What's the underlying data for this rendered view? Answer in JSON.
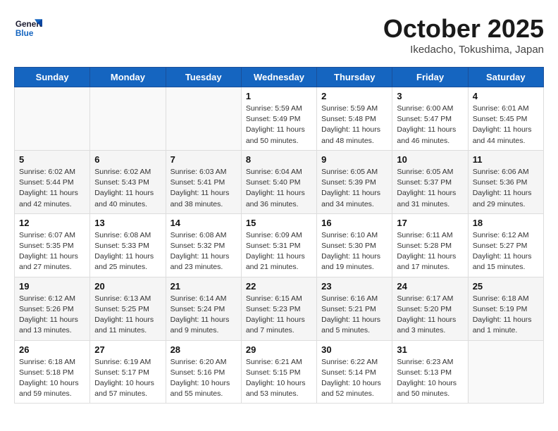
{
  "header": {
    "logo_line1": "General",
    "logo_line2": "Blue",
    "month": "October 2025",
    "location": "Ikedacho, Tokushima, Japan"
  },
  "weekdays": [
    "Sunday",
    "Monday",
    "Tuesday",
    "Wednesday",
    "Thursday",
    "Friday",
    "Saturday"
  ],
  "weeks": [
    [
      {
        "day": "",
        "info": ""
      },
      {
        "day": "",
        "info": ""
      },
      {
        "day": "",
        "info": ""
      },
      {
        "day": "1",
        "info": "Sunrise: 5:59 AM\nSunset: 5:49 PM\nDaylight: 11 hours and 50 minutes."
      },
      {
        "day": "2",
        "info": "Sunrise: 5:59 AM\nSunset: 5:48 PM\nDaylight: 11 hours and 48 minutes."
      },
      {
        "day": "3",
        "info": "Sunrise: 6:00 AM\nSunset: 5:47 PM\nDaylight: 11 hours and 46 minutes."
      },
      {
        "day": "4",
        "info": "Sunrise: 6:01 AM\nSunset: 5:45 PM\nDaylight: 11 hours and 44 minutes."
      }
    ],
    [
      {
        "day": "5",
        "info": "Sunrise: 6:02 AM\nSunset: 5:44 PM\nDaylight: 11 hours and 42 minutes."
      },
      {
        "day": "6",
        "info": "Sunrise: 6:02 AM\nSunset: 5:43 PM\nDaylight: 11 hours and 40 minutes."
      },
      {
        "day": "7",
        "info": "Sunrise: 6:03 AM\nSunset: 5:41 PM\nDaylight: 11 hours and 38 minutes."
      },
      {
        "day": "8",
        "info": "Sunrise: 6:04 AM\nSunset: 5:40 PM\nDaylight: 11 hours and 36 minutes."
      },
      {
        "day": "9",
        "info": "Sunrise: 6:05 AM\nSunset: 5:39 PM\nDaylight: 11 hours and 34 minutes."
      },
      {
        "day": "10",
        "info": "Sunrise: 6:05 AM\nSunset: 5:37 PM\nDaylight: 11 hours and 31 minutes."
      },
      {
        "day": "11",
        "info": "Sunrise: 6:06 AM\nSunset: 5:36 PM\nDaylight: 11 hours and 29 minutes."
      }
    ],
    [
      {
        "day": "12",
        "info": "Sunrise: 6:07 AM\nSunset: 5:35 PM\nDaylight: 11 hours and 27 minutes."
      },
      {
        "day": "13",
        "info": "Sunrise: 6:08 AM\nSunset: 5:33 PM\nDaylight: 11 hours and 25 minutes."
      },
      {
        "day": "14",
        "info": "Sunrise: 6:08 AM\nSunset: 5:32 PM\nDaylight: 11 hours and 23 minutes."
      },
      {
        "day": "15",
        "info": "Sunrise: 6:09 AM\nSunset: 5:31 PM\nDaylight: 11 hours and 21 minutes."
      },
      {
        "day": "16",
        "info": "Sunrise: 6:10 AM\nSunset: 5:30 PM\nDaylight: 11 hours and 19 minutes."
      },
      {
        "day": "17",
        "info": "Sunrise: 6:11 AM\nSunset: 5:28 PM\nDaylight: 11 hours and 17 minutes."
      },
      {
        "day": "18",
        "info": "Sunrise: 6:12 AM\nSunset: 5:27 PM\nDaylight: 11 hours and 15 minutes."
      }
    ],
    [
      {
        "day": "19",
        "info": "Sunrise: 6:12 AM\nSunset: 5:26 PM\nDaylight: 11 hours and 13 minutes."
      },
      {
        "day": "20",
        "info": "Sunrise: 6:13 AM\nSunset: 5:25 PM\nDaylight: 11 hours and 11 minutes."
      },
      {
        "day": "21",
        "info": "Sunrise: 6:14 AM\nSunset: 5:24 PM\nDaylight: 11 hours and 9 minutes."
      },
      {
        "day": "22",
        "info": "Sunrise: 6:15 AM\nSunset: 5:23 PM\nDaylight: 11 hours and 7 minutes."
      },
      {
        "day": "23",
        "info": "Sunrise: 6:16 AM\nSunset: 5:21 PM\nDaylight: 11 hours and 5 minutes."
      },
      {
        "day": "24",
        "info": "Sunrise: 6:17 AM\nSunset: 5:20 PM\nDaylight: 11 hours and 3 minutes."
      },
      {
        "day": "25",
        "info": "Sunrise: 6:18 AM\nSunset: 5:19 PM\nDaylight: 11 hours and 1 minute."
      }
    ],
    [
      {
        "day": "26",
        "info": "Sunrise: 6:18 AM\nSunset: 5:18 PM\nDaylight: 10 hours and 59 minutes."
      },
      {
        "day": "27",
        "info": "Sunrise: 6:19 AM\nSunset: 5:17 PM\nDaylight: 10 hours and 57 minutes."
      },
      {
        "day": "28",
        "info": "Sunrise: 6:20 AM\nSunset: 5:16 PM\nDaylight: 10 hours and 55 minutes."
      },
      {
        "day": "29",
        "info": "Sunrise: 6:21 AM\nSunset: 5:15 PM\nDaylight: 10 hours and 53 minutes."
      },
      {
        "day": "30",
        "info": "Sunrise: 6:22 AM\nSunset: 5:14 PM\nDaylight: 10 hours and 52 minutes."
      },
      {
        "day": "31",
        "info": "Sunrise: 6:23 AM\nSunset: 5:13 PM\nDaylight: 10 hours and 50 minutes."
      },
      {
        "day": "",
        "info": ""
      }
    ]
  ]
}
